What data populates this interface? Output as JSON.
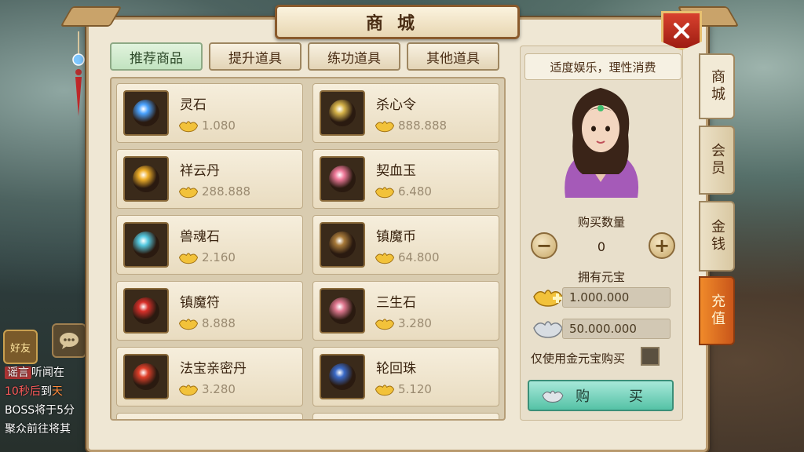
{
  "window": {
    "title": "商城",
    "close_icon": "close-icon"
  },
  "tabs": [
    {
      "label": "推荐商品",
      "active": true
    },
    {
      "label": "提升道具",
      "active": false
    },
    {
      "label": "练功道具",
      "active": false
    },
    {
      "label": "其他道具",
      "active": false
    }
  ],
  "items": [
    {
      "name": "灵石",
      "price": "1.080",
      "icon": "blue-crystal-icon",
      "color": "#4aa3ff"
    },
    {
      "name": "杀心令",
      "price": "888.888",
      "icon": "golden-token-icon",
      "color": "#d7b44a"
    },
    {
      "name": "祥云丹",
      "price": "288.888",
      "icon": "golden-pill-icon",
      "color": "#f0b02a"
    },
    {
      "name": "契血玉",
      "price": "6.480",
      "icon": "pink-jade-icon",
      "color": "#f07a9a"
    },
    {
      "name": "兽魂石",
      "price": "2.160",
      "icon": "cyan-gem-icon",
      "color": "#55c9e0"
    },
    {
      "name": "镇魔币",
      "price": "64.800",
      "icon": "bronze-coin-icon",
      "color": "#a87a3a"
    },
    {
      "name": "镇魔符",
      "price": "8.888",
      "icon": "red-talisman-icon",
      "color": "#d8302a"
    },
    {
      "name": "三生石",
      "price": "3.280",
      "icon": "pink-stone-icon",
      "color": "#e07890"
    },
    {
      "name": "法宝亲密丹",
      "price": "3.280",
      "icon": "red-pill-icon",
      "color": "#e0402a"
    },
    {
      "name": "轮回珠",
      "price": "5.120",
      "icon": "blue-orb-icon",
      "color": "#3a6ac8"
    }
  ],
  "side": {
    "motto": "适度娱乐，理性消费",
    "qty_label": "购买数量",
    "qty_value": "0",
    "owned_label": "拥有元宝",
    "gold_amount": "1.000.000",
    "silver_amount": "50.000.000",
    "gold_only_label": "仅使用金元宝购买",
    "buy_label": "购 买"
  },
  "side_tabs": [
    {
      "label": "商城",
      "active": true
    },
    {
      "label": "会员",
      "active": false
    },
    {
      "label": "金钱",
      "active": false
    },
    {
      "label": "充值",
      "active": false
    }
  ],
  "chat": {
    "friends_label": "好友",
    "tag": "谣言",
    "line1": "听闻在",
    "line2_red": "10秒后",
    "line2_mid": "到",
    "line2_orange": "天",
    "line3": "BOSS将于5分",
    "line4": "聚众前往将其"
  },
  "colors": {
    "gold_accent": "#e8b52a",
    "buy_button": "#55c2a6",
    "charge_tab": "#e0772a",
    "close_red": "#c23322"
  }
}
